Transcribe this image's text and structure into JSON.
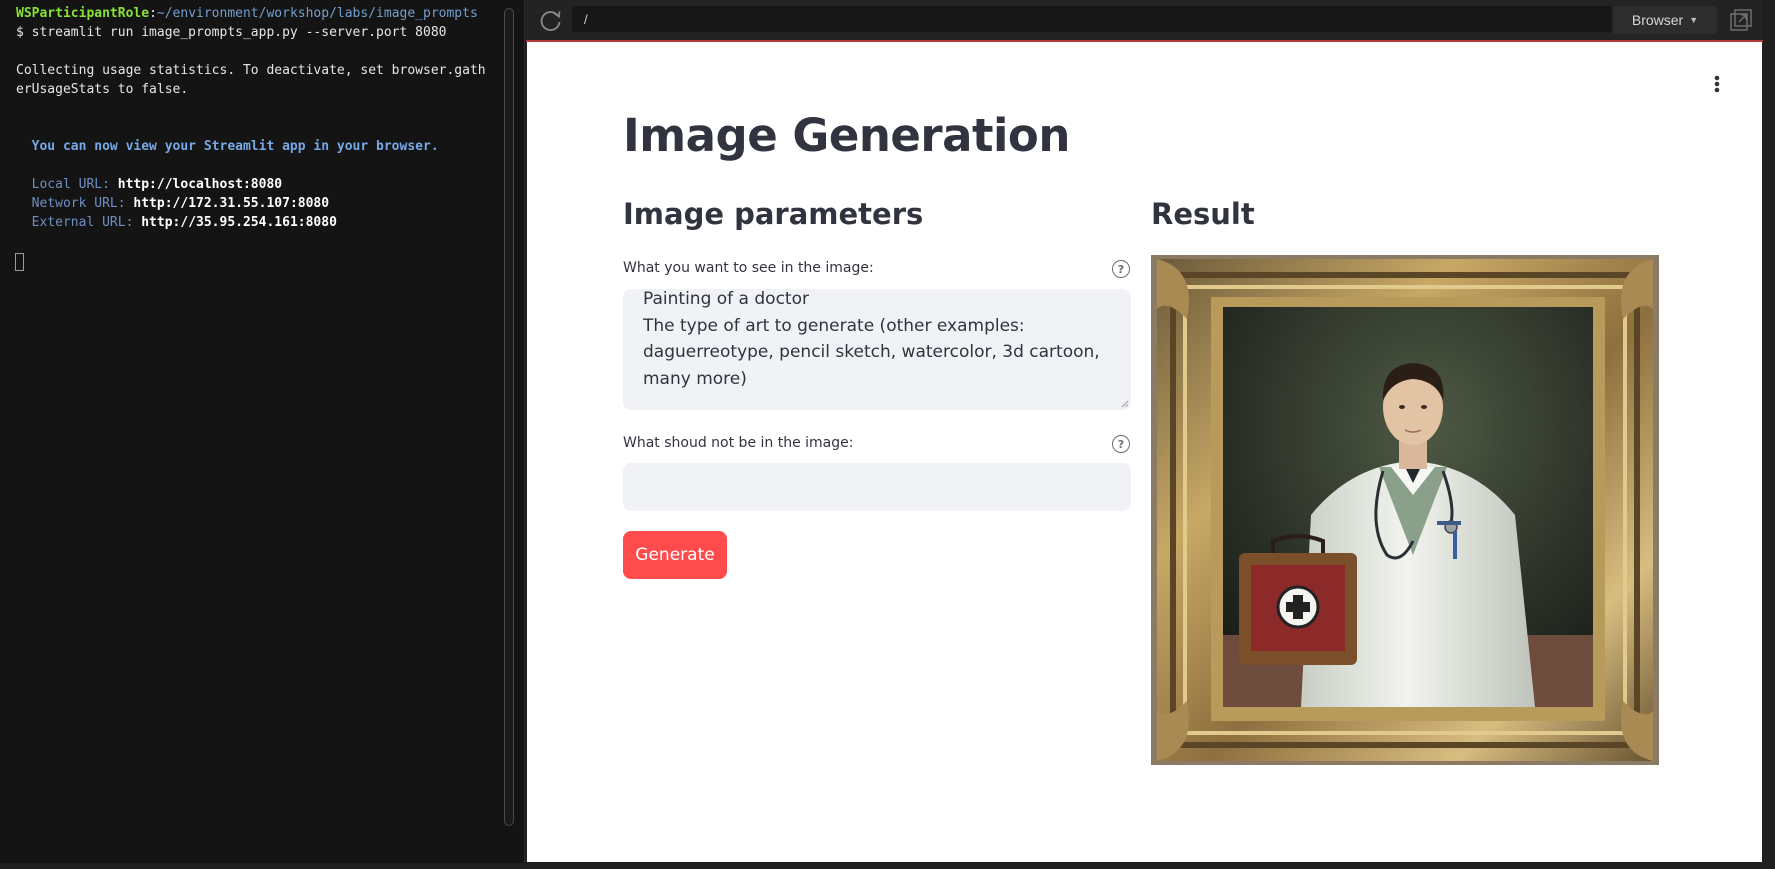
{
  "terminal": {
    "user": "WSParticipantRole",
    "colon": ":",
    "path": "~/environment/workshop/labs/image_prompts",
    "command": "$ streamlit run image_prompts_app.py --server.port 8080",
    "collect_line1": "Collecting usage statistics. To deactivate, set browser.gath",
    "collect_line2": "erUsageStats to false.",
    "view_msg": "  You can now view your Streamlit app in your browser.",
    "local_label": "  Local URL: ",
    "local_url": "http://localhost:8080",
    "network_label": "  Network URL: ",
    "network_url": "http://172.31.55.107:8080",
    "external_label": "  External URL: ",
    "external_url": "http://35.95.254.161:8080"
  },
  "browser": {
    "url": "/",
    "browser_button_label": "Browser"
  },
  "app": {
    "title": "Image Generation",
    "params_heading": "Image parameters",
    "result_heading": "Result",
    "prompt_label": "What you want to see in the image:",
    "prompt_lines": [
      "Painting of a doctor",
      "The type of art to generate (other examples:",
      "daguerreotype, pencil sketch, watercolor, 3d cartoon,",
      "many more)"
    ],
    "negative_label": "What shoud not be in the image:",
    "negative_value": "",
    "generate_label": "Generate",
    "help_glyph": "?"
  },
  "colors": {
    "accent": "#ff4b4b",
    "text": "#31333f",
    "input_bg": "#f0f2f6",
    "terminal_bg": "#141414"
  }
}
